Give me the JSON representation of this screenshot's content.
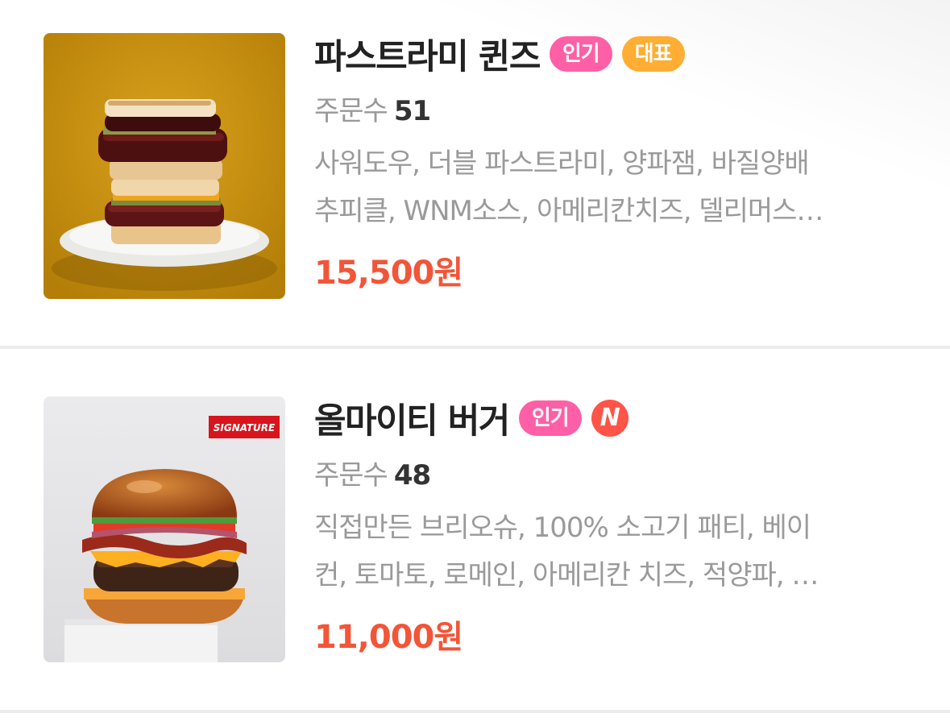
{
  "menu": {
    "orders_label": "주문수",
    "items": [
      {
        "name": "파스트라미 퀸즈",
        "badges": {
          "popular": "인기",
          "representative": "대표"
        },
        "order_count": "51",
        "description_line1": "사워도우, 더블 파스트라미, 양파잼, 바질양배",
        "description_line2": "추피클, WNM소스, 아메리칸치즈, 델리머스…",
        "price": "15,500원",
        "image_icon": "pastrami-sandwich-photo"
      },
      {
        "name": "올마이티 버거",
        "badges": {
          "popular": "인기",
          "new": "N"
        },
        "order_count": "48",
        "description_line1": "직접만든 브리오슈, 100% 소고기 패티, 베이",
        "description_line2": "컨, 토마토, 로메인, 아메리칸 치즈, 적양파, …",
        "price": "11,000원",
        "image_label": "SIGNATURE",
        "image_icon": "burger-photo"
      }
    ]
  },
  "colors": {
    "price": "#f25538",
    "badge_popular": "#ff5fa6",
    "badge_representative": "#ffad33",
    "badge_new": "#ff5447"
  }
}
